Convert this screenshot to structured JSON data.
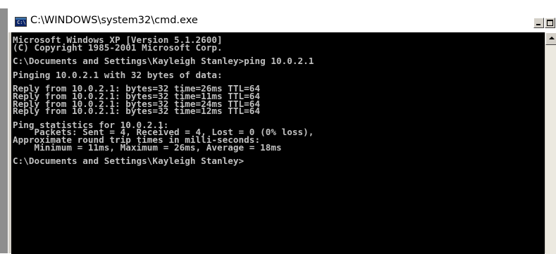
{
  "window": {
    "title": "C:\\WINDOWS\\system32\\cmd.exe",
    "icon": "cmd-icon",
    "icon_text": "C:\\"
  },
  "controls": {
    "minimize": "minimize-icon",
    "maximize": "maximize-icon",
    "close": "close-icon"
  },
  "console": {
    "lines": [
      "Microsoft Windows XP [Version 5.1.2600]",
      "(C) Copyright 1985-2001 Microsoft Corp.",
      "",
      "C:\\Documents and Settings\\Kayleigh Stanley>ping 10.0.2.1",
      "",
      "Pinging 10.0.2.1 with 32 bytes of data:",
      "",
      "Reply from 10.0.2.1: bytes=32 time=26ms TTL=64",
      "Reply from 10.0.2.1: bytes=32 time=11ms TTL=64",
      "Reply from 10.0.2.1: bytes=32 time=24ms TTL=64",
      "Reply from 10.0.2.1: bytes=32 time=12ms TTL=64",
      "",
      "Ping statistics for 10.0.2.1:",
      "    Packets: Sent = 4, Received = 4, Lost = 0 (0% loss),",
      "Approximate round trip times in milli-seconds:",
      "    Minimum = 11ms, Maximum = 26ms, Average = 18ms",
      "",
      "C:\\Documents and Settings\\Kayleigh Stanley>"
    ]
  },
  "colors": {
    "console_background": "#000000",
    "console_text": "#c0c0c0",
    "titlebar_background": "#ffffff"
  }
}
